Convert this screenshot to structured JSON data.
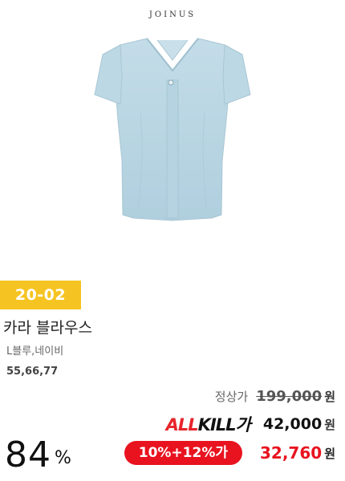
{
  "brand": {
    "logo_text": "JOINUS"
  },
  "product": {
    "image_icon": "blouse-product-image",
    "code_badge": "20-02",
    "name": "카라 블라우스",
    "colors": "L블루,네이비",
    "sizes": "55,66,77"
  },
  "pricing": {
    "regular_label": "정상가",
    "regular_price": "199,000",
    "currency": "원",
    "allkill_logo_a": "ALL",
    "allkill_logo_b": "KILL",
    "allkill_logo_c": "가",
    "allkill_price": "42,000",
    "discount_badge": "10%+12%가",
    "final_price": "32,760",
    "discount_rate": "84",
    "discount_rate_unit": "%"
  },
  "colors": {
    "badge_yellow": "#f6c422",
    "sale_red": "#e8131f",
    "blouse_blue": "#b9d6e3"
  }
}
